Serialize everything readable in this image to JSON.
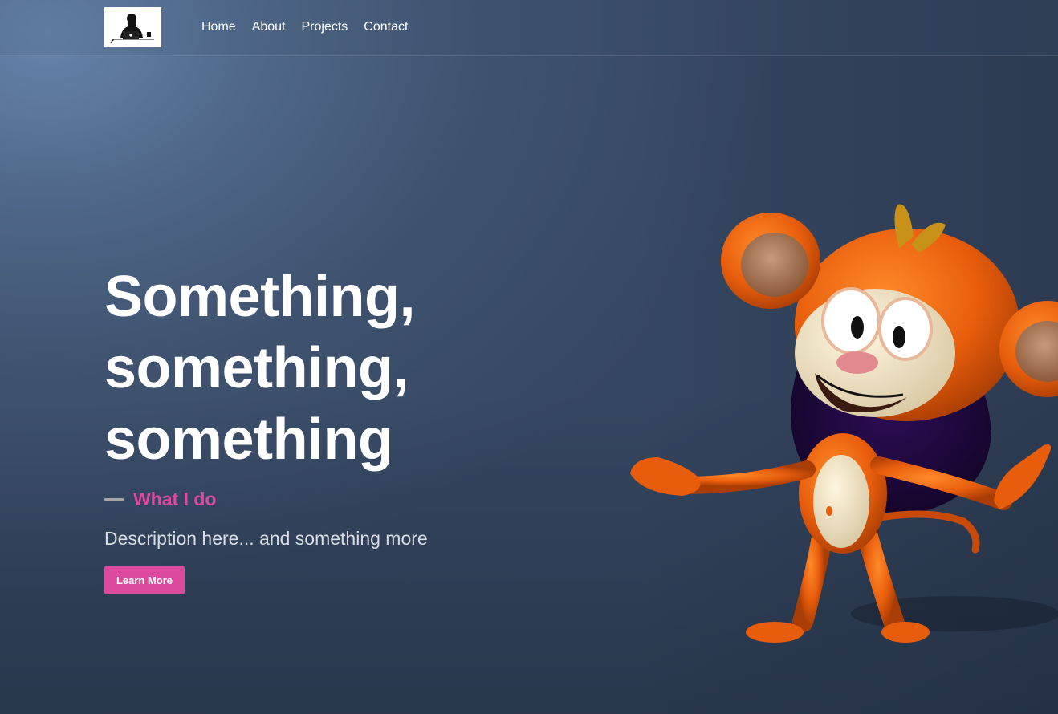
{
  "nav": {
    "logo_alt": "logo",
    "links": [
      {
        "label": "Home"
      },
      {
        "label": "About"
      },
      {
        "label": "Projects"
      },
      {
        "label": "Contact"
      }
    ]
  },
  "hero": {
    "title_lines": [
      "Something,",
      "something,",
      "something"
    ],
    "section_label": "What I do",
    "description": "Description here... and something more",
    "cta_label": "Learn More"
  },
  "colors": {
    "accent": "#dc4a9c",
    "background_top": "#6585ad",
    "background_bottom": "#354660",
    "mascot_primary": "#e85d0c"
  },
  "images": {
    "logo": "person-at-laptop-logo",
    "mascot": "orange-monkey-mascot"
  }
}
